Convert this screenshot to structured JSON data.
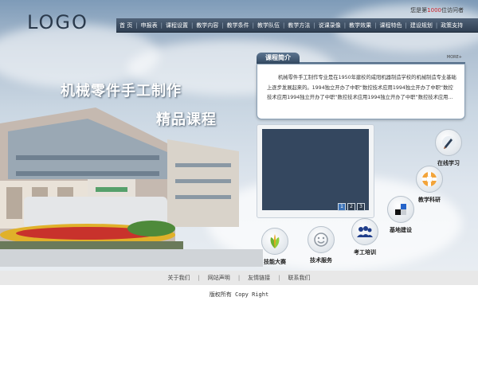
{
  "header": {
    "logo": "LOGO",
    "visitor_prefix": "您是第",
    "visitor_count": "1000",
    "visitor_suffix": "位访问者"
  },
  "nav": [
    "首 页",
    "申报表",
    "课程设置",
    "教学内容",
    "教学条件",
    "教学队伍",
    "教学方法",
    "说课录像",
    "教学效果",
    "课程特色",
    "建设规划",
    "政策支持"
  ],
  "banner": {
    "title_line1": "机械零件手工制作",
    "title_line2": "精品课程"
  },
  "intro": {
    "tab_label": "课程简介",
    "more": "MORE+",
    "text": "机械零件手工制作专业是在1950年建校的咸阳机器制造学校的机械制造专业基础上逐步发展起来的。1994独立开办了中职“数控技术应用1994独立开办了中职“数控技术应用1994独立开办了中职“数控技术应用1994独立开办了中职“数控技术应用..."
  },
  "video": {
    "pages": [
      "1",
      "2",
      "3"
    ]
  },
  "features": [
    {
      "label": "在线学习",
      "icon": "pen-icon"
    },
    {
      "label": "教学科研",
      "icon": "lifebuoy-icon"
    },
    {
      "label": "基地建设",
      "icon": "blocks-icon"
    },
    {
      "label": "考工培训",
      "icon": "people-icon"
    },
    {
      "label": "技术服务",
      "icon": "smiley-icon"
    },
    {
      "label": "技能大赛",
      "icon": "leaf-icon"
    }
  ],
  "footer": {
    "links": [
      "关于我们",
      "网站声明",
      "友情链接",
      "联系我们"
    ],
    "copyright": "版权所有 Copy Right"
  }
}
